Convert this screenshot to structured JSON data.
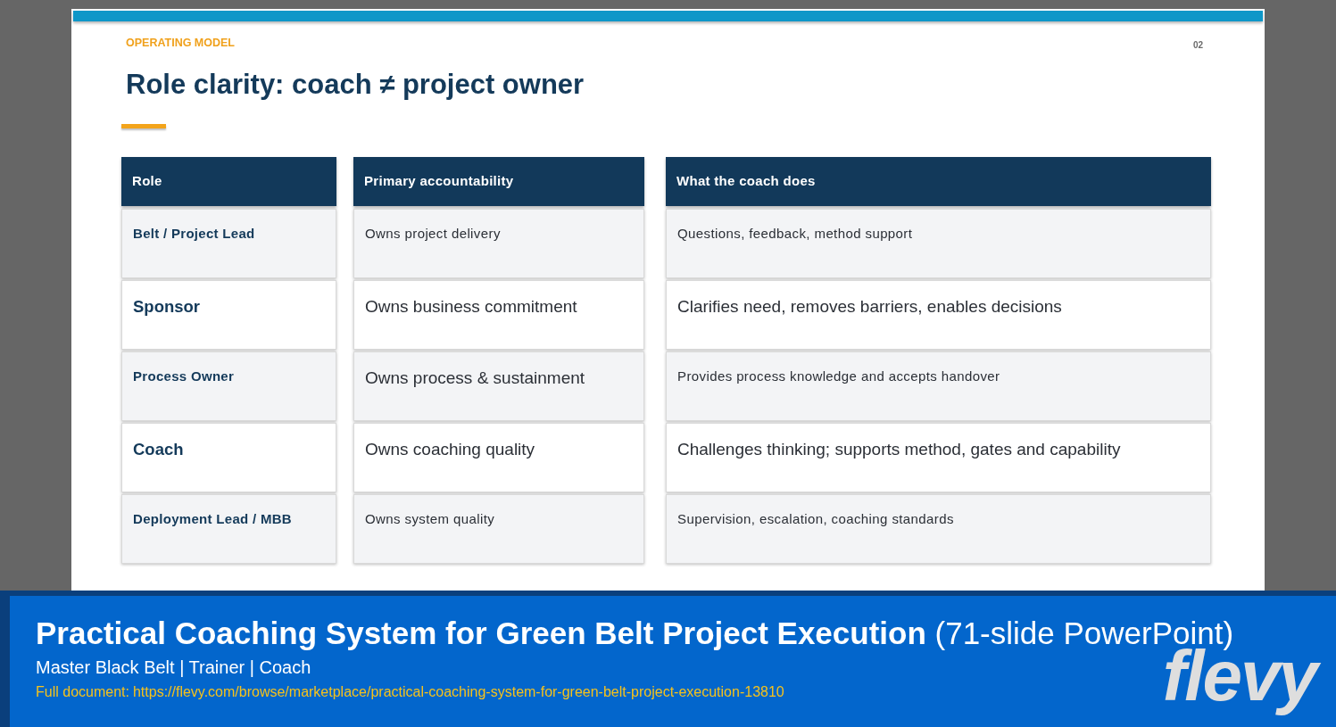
{
  "slide": {
    "eyebrow": "OPERATING MODEL",
    "page_number": "02",
    "title": "Role clarity: coach ≠ project owner"
  },
  "table": {
    "columns": [
      "Role",
      "Primary accountability",
      "What the coach does"
    ],
    "rows": [
      [
        "Belt / Project Lead",
        "Owns project delivery",
        "Questions, feedback, method support"
      ],
      [
        "Sponsor",
        "Owns business commitment",
        "Clarifies need, removes barriers, enables decisions"
      ],
      [
        "Process Owner",
        "Owns process & sustainment",
        "Provides process knowledge and accepts handover"
      ],
      [
        "Coach",
        "Owns coaching quality",
        "Challenges thinking; supports method, gates and capability"
      ],
      [
        "Deployment Lead / MBB",
        "Owns system quality",
        "Supervision, escalation, coaching standards"
      ]
    ]
  },
  "banner": {
    "title": "**Practical Coaching System for Green Belt Project Execution** (71-slide PowerPoint)",
    "subtitle": "Master Black Belt | Trainer | Coach",
    "link_label": "Full document:",
    "link_url": "https://flevy.com/browse/marketplace/practical-coaching-system-for-green-belt-project-execution-13810",
    "logo": "flevy"
  }
}
